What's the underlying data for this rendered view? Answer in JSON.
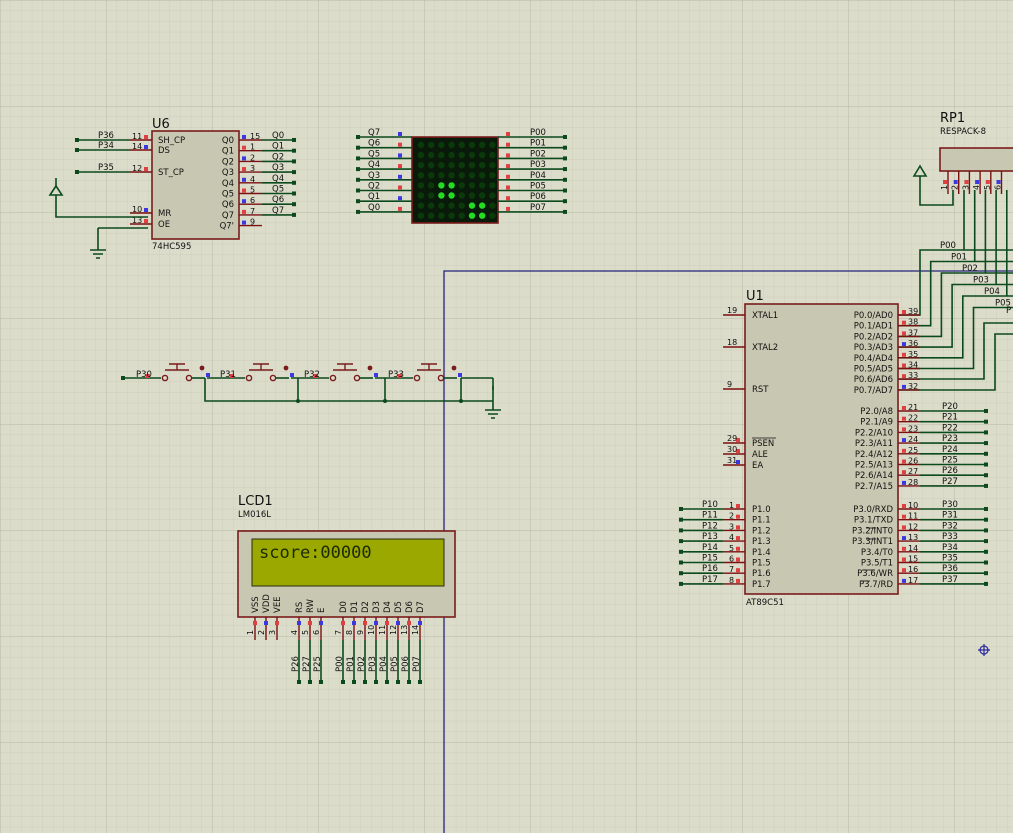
{
  "colors": {
    "background": "#dcdccb",
    "grid_minor": "#c9c9b6",
    "grid_major": "#b9b9a4",
    "body": "#c8c8b2",
    "outline": "#7a1c1c",
    "wire": "#0b4a1c",
    "bus": "#24247a",
    "lcd_screen": "#9aa800",
    "led_on": "#22dd22",
    "led_off": "#0a3a0a",
    "pin_red": "#e04040",
    "pin_blue": "#3a3ae0"
  },
  "u6": {
    "ref": "U6",
    "type": "74HC595",
    "left_pins": [
      {
        "num": "11",
        "name": "SH_CP",
        "net": "P36"
      },
      {
        "num": "14",
        "name": "DS",
        "net": "P34"
      },
      {
        "num": "12",
        "name": "ST_CP",
        "net": "P35"
      },
      {
        "num": "10",
        "name": "MR",
        "net": ""
      },
      {
        "num": "13",
        "name": "OE",
        "net": ""
      }
    ],
    "right_pins": [
      {
        "num": "15",
        "name": "Q0",
        "net": "Q0"
      },
      {
        "num": "1",
        "name": "Q1",
        "net": "Q1"
      },
      {
        "num": "2",
        "name": "Q2",
        "net": "Q2"
      },
      {
        "num": "3",
        "name": "Q3",
        "net": "Q3"
      },
      {
        "num": "4",
        "name": "Q4",
        "net": "Q4"
      },
      {
        "num": "5",
        "name": "Q5",
        "net": "Q5"
      },
      {
        "num": "6",
        "name": "Q6",
        "net": "Q6"
      },
      {
        "num": "7",
        "name": "Q7",
        "net": "Q7"
      },
      {
        "num": "9",
        "name": "Q7'",
        "net": ""
      }
    ]
  },
  "matrix": {
    "left_nets": [
      "Q7",
      "Q6",
      "Q5",
      "Q4",
      "Q3",
      "Q2",
      "Q1",
      "Q0"
    ],
    "right_nets": [
      "P00",
      "P01",
      "P02",
      "P03",
      "P04",
      "P05",
      "P06",
      "P07"
    ],
    "leds": [
      [
        0,
        0,
        0,
        0,
        0,
        0,
        0,
        0
      ],
      [
        0,
        0,
        0,
        0,
        0,
        0,
        0,
        0
      ],
      [
        0,
        0,
        0,
        0,
        0,
        0,
        0,
        0
      ],
      [
        0,
        0,
        0,
        0,
        0,
        0,
        0,
        0
      ],
      [
        0,
        0,
        1,
        1,
        0,
        0,
        0,
        0
      ],
      [
        0,
        0,
        1,
        1,
        0,
        0,
        0,
        0
      ],
      [
        0,
        0,
        0,
        0,
        0,
        1,
        1,
        0
      ],
      [
        0,
        0,
        0,
        0,
        0,
        1,
        1,
        0
      ]
    ]
  },
  "rp1": {
    "ref": "RP1",
    "type": "RESPACK-8",
    "pins": [
      "1",
      "2",
      "3",
      "4",
      "5",
      "6"
    ]
  },
  "u1": {
    "ref": "U1",
    "type": "AT89C51",
    "left_top": [
      {
        "num": "19",
        "name": "XTAL1"
      },
      {
        "num": "18",
        "name": "XTAL2"
      },
      {
        "num": "9",
        "name": "RST"
      },
      {
        "num": "29",
        "name": "PSEN"
      },
      {
        "num": "30",
        "name": "ALE"
      },
      {
        "num": "31",
        "name": "EA"
      }
    ],
    "left_p1": [
      {
        "num": "1",
        "name": "P1.0",
        "net": "P10"
      },
      {
        "num": "2",
        "name": "P1.1",
        "net": "P11"
      },
      {
        "num": "3",
        "name": "P1.2",
        "net": "P12"
      },
      {
        "num": "4",
        "name": "P1.3",
        "net": "P13"
      },
      {
        "num": "5",
        "name": "P1.4",
        "net": "P14"
      },
      {
        "num": "6",
        "name": "P1.5",
        "net": "P15"
      },
      {
        "num": "7",
        "name": "P1.6",
        "net": "P16"
      },
      {
        "num": "8",
        "name": "P1.7",
        "net": "P17"
      }
    ],
    "right_p0": [
      {
        "num": "39",
        "name": "P0.0/AD0",
        "net": "P00"
      },
      {
        "num": "38",
        "name": "P0.1/AD1",
        "net": "P01"
      },
      {
        "num": "37",
        "name": "P0.2/AD2",
        "net": "P02"
      },
      {
        "num": "36",
        "name": "P0.3/AD3",
        "net": "P03"
      },
      {
        "num": "35",
        "name": "P0.4/AD4",
        "net": "P04"
      },
      {
        "num": "34",
        "name": "P0.5/AD5",
        "net": "P05"
      },
      {
        "num": "33",
        "name": "P0.6/AD6",
        "net": "P"
      },
      {
        "num": "32",
        "name": "P0.7/AD7",
        "net": ""
      }
    ],
    "right_p2": [
      {
        "num": "21",
        "name": "P2.0/A8",
        "net": "P20"
      },
      {
        "num": "22",
        "name": "P2.1/A9",
        "net": "P21"
      },
      {
        "num": "23",
        "name": "P2.2/A10",
        "net": "P22"
      },
      {
        "num": "24",
        "name": "P2.3/A11",
        "net": "P23"
      },
      {
        "num": "25",
        "name": "P2.4/A12",
        "net": "P24"
      },
      {
        "num": "26",
        "name": "P2.5/A13",
        "net": "P25"
      },
      {
        "num": "27",
        "name": "P2.6/A14",
        "net": "P26"
      },
      {
        "num": "28",
        "name": "P2.7/A15",
        "net": "P27"
      }
    ],
    "right_p3": [
      {
        "num": "10",
        "name": "P3.0/RXD",
        "net": "P30"
      },
      {
        "num": "11",
        "name": "P3.1/TXD",
        "net": "P31"
      },
      {
        "num": "12",
        "name": "P3.2/INT0",
        "net": "P32"
      },
      {
        "num": "13",
        "name": "P3.3/INT1",
        "net": "P33"
      },
      {
        "num": "14",
        "name": "P3.4/T0",
        "net": "P34"
      },
      {
        "num": "15",
        "name": "P3.5/T1",
        "net": "P35"
      },
      {
        "num": "16",
        "name": "P3.6/WR",
        "net": "P36"
      },
      {
        "num": "17",
        "name": "P3.7/RD",
        "net": "P37"
      }
    ]
  },
  "buttons": [
    {
      "net": "P30"
    },
    {
      "net": "P31"
    },
    {
      "net": "P32"
    },
    {
      "net": "P33"
    }
  ],
  "lcd1": {
    "ref": "LCD1",
    "type": "LM016L",
    "display": "score:00000",
    "pins": [
      {
        "num": "1",
        "name": "VSS",
        "net": ""
      },
      {
        "num": "2",
        "name": "VDD",
        "net": ""
      },
      {
        "num": "3",
        "name": "VEE",
        "net": ""
      },
      {
        "num": "4",
        "name": "RS",
        "net": "P26"
      },
      {
        "num": "5",
        "name": "RW",
        "net": "P27"
      },
      {
        "num": "6",
        "name": "E",
        "net": "P25"
      },
      {
        "num": "7",
        "name": "D0",
        "net": "P00"
      },
      {
        "num": "8",
        "name": "D1",
        "net": "P01"
      },
      {
        "num": "9",
        "name": "D2",
        "net": "P02"
      },
      {
        "num": "10",
        "name": "D3",
        "net": "P03"
      },
      {
        "num": "11",
        "name": "D4",
        "net": "P04"
      },
      {
        "num": "12",
        "name": "D5",
        "net": "P05"
      },
      {
        "num": "13",
        "name": "D6",
        "net": "P06"
      },
      {
        "num": "14",
        "name": "D7",
        "net": "P07"
      }
    ]
  }
}
